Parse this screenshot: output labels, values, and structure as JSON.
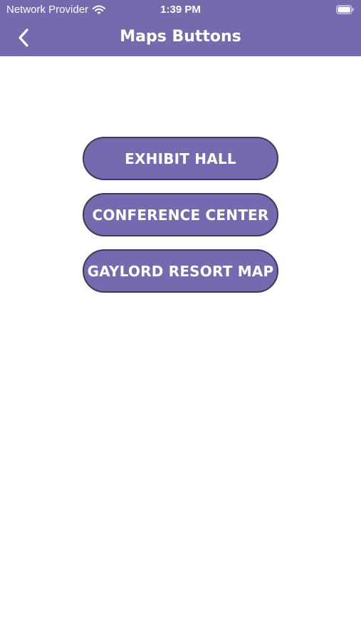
{
  "status_bar": {
    "carrier": "Network Provider",
    "time": "1:39 PM",
    "wifi_icon": "wifi-icon",
    "battery_icon": "battery-icon"
  },
  "nav": {
    "title": "Maps Buttons",
    "back_icon": "chevron-left-icon"
  },
  "buttons": [
    {
      "label": "EXHIBIT HALL"
    },
    {
      "label": "CONFERENCE CENTER"
    },
    {
      "label": "GAYLORD RESORT MAP"
    }
  ],
  "colors": {
    "header": "#766aaf",
    "button_fill": "#7569b0",
    "button_border": "#3f3a55",
    "text": "#ffffff",
    "background": "#ffffff"
  }
}
